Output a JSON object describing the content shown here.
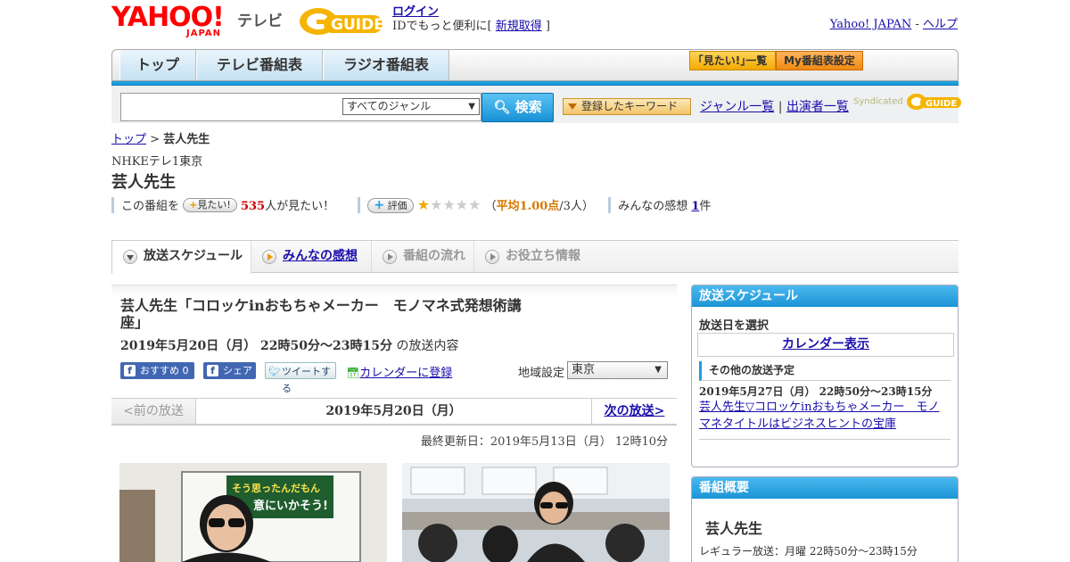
{
  "header": {
    "logo_text": "YAHOO!",
    "logo_sub": "JAPAN",
    "tv_label": "テレビ",
    "gguide": "GUIDE",
    "login": "ログイン",
    "login_desc": "IDでもっと便利に[ ",
    "register": "新規取得",
    "login_desc_end": " ]",
    "yahoo_japan": "Yahoo! JAPAN",
    "sep": " - ",
    "help": "ヘルプ"
  },
  "nav": {
    "tabs": [
      "トップ",
      "テレビ番組表",
      "ラジオ番組表"
    ],
    "mitai_list": "｢見たい!｣一覧",
    "my_schedule": "My番組表設定"
  },
  "search": {
    "genre_selected": "すべてのジャンル",
    "button": "検索",
    "keyword_btn": "登録したキーワード",
    "genre_list": "ジャンル一覧",
    "divider": " | ",
    "cast_list": "出演者一覧",
    "syndicated": "Syndicated"
  },
  "breadcrumb": {
    "top": "トップ",
    "sep": " > ",
    "current": "芸人先生"
  },
  "program": {
    "channel": "NHKEテレ1東京",
    "title": "芸人先生",
    "want_prefix": "この番組を",
    "want_btn": "見たい!",
    "want_count": "535",
    "want_suffix": "人が見たい！",
    "rate_btn": "評価",
    "rating": 1,
    "rating_open": "（",
    "rating_avg": "平均1.00点",
    "rating_people": "/3人）",
    "impressions_label": "みんなの感想 ",
    "impressions_count": "1",
    "impressions_suffix": "件"
  },
  "subtabs": [
    "放送スケジュール",
    "みんなの感想",
    "番組の流れ",
    "お役立ち情報"
  ],
  "episode": {
    "title": "芸人先生「コロッケinおもちゃメーカー　モノマネ式発想術講座」",
    "date": "2019年5月20日（月） 22時50分～23時15分",
    "date_suffix": "の放送内容",
    "fb_recommend": "おすすめ 0",
    "fb_share": "シェア",
    "tweet": "ツイートする",
    "calendar": "カレンダーに登録",
    "region_label": "地域設定",
    "region": "東京",
    "prev": "<前の放送",
    "pager_date": "2019年5月20日（月）",
    "next": "次の放送>",
    "updated": "最終更新日：2019年5月13日（月） 12時10分",
    "photo1_text": "そう思ったんだもん 意にいかそう!"
  },
  "sidebar": {
    "schedule_title": "放送スケジュール",
    "select_date": "放送日を選択",
    "calendar_show": "カレンダー表示",
    "other_label": "その他の放送予定",
    "other_date": "2019年5月27日（月） 22時50分～23時15分",
    "other_title": "芸人先生▽コロッケinおもちゃメーカー　モノマネタイトルはビジネスヒントの宝庫",
    "overview_title": "番組概要",
    "overview_name": "芸人先生",
    "regular": "レギュラー放送：月曜 22時50分～23時15分"
  },
  "colors": {
    "accent_blue": "#1b9ee0",
    "link": "#1a0dab",
    "want_red": "#cc0000",
    "rating_orange": "#d67800"
  }
}
